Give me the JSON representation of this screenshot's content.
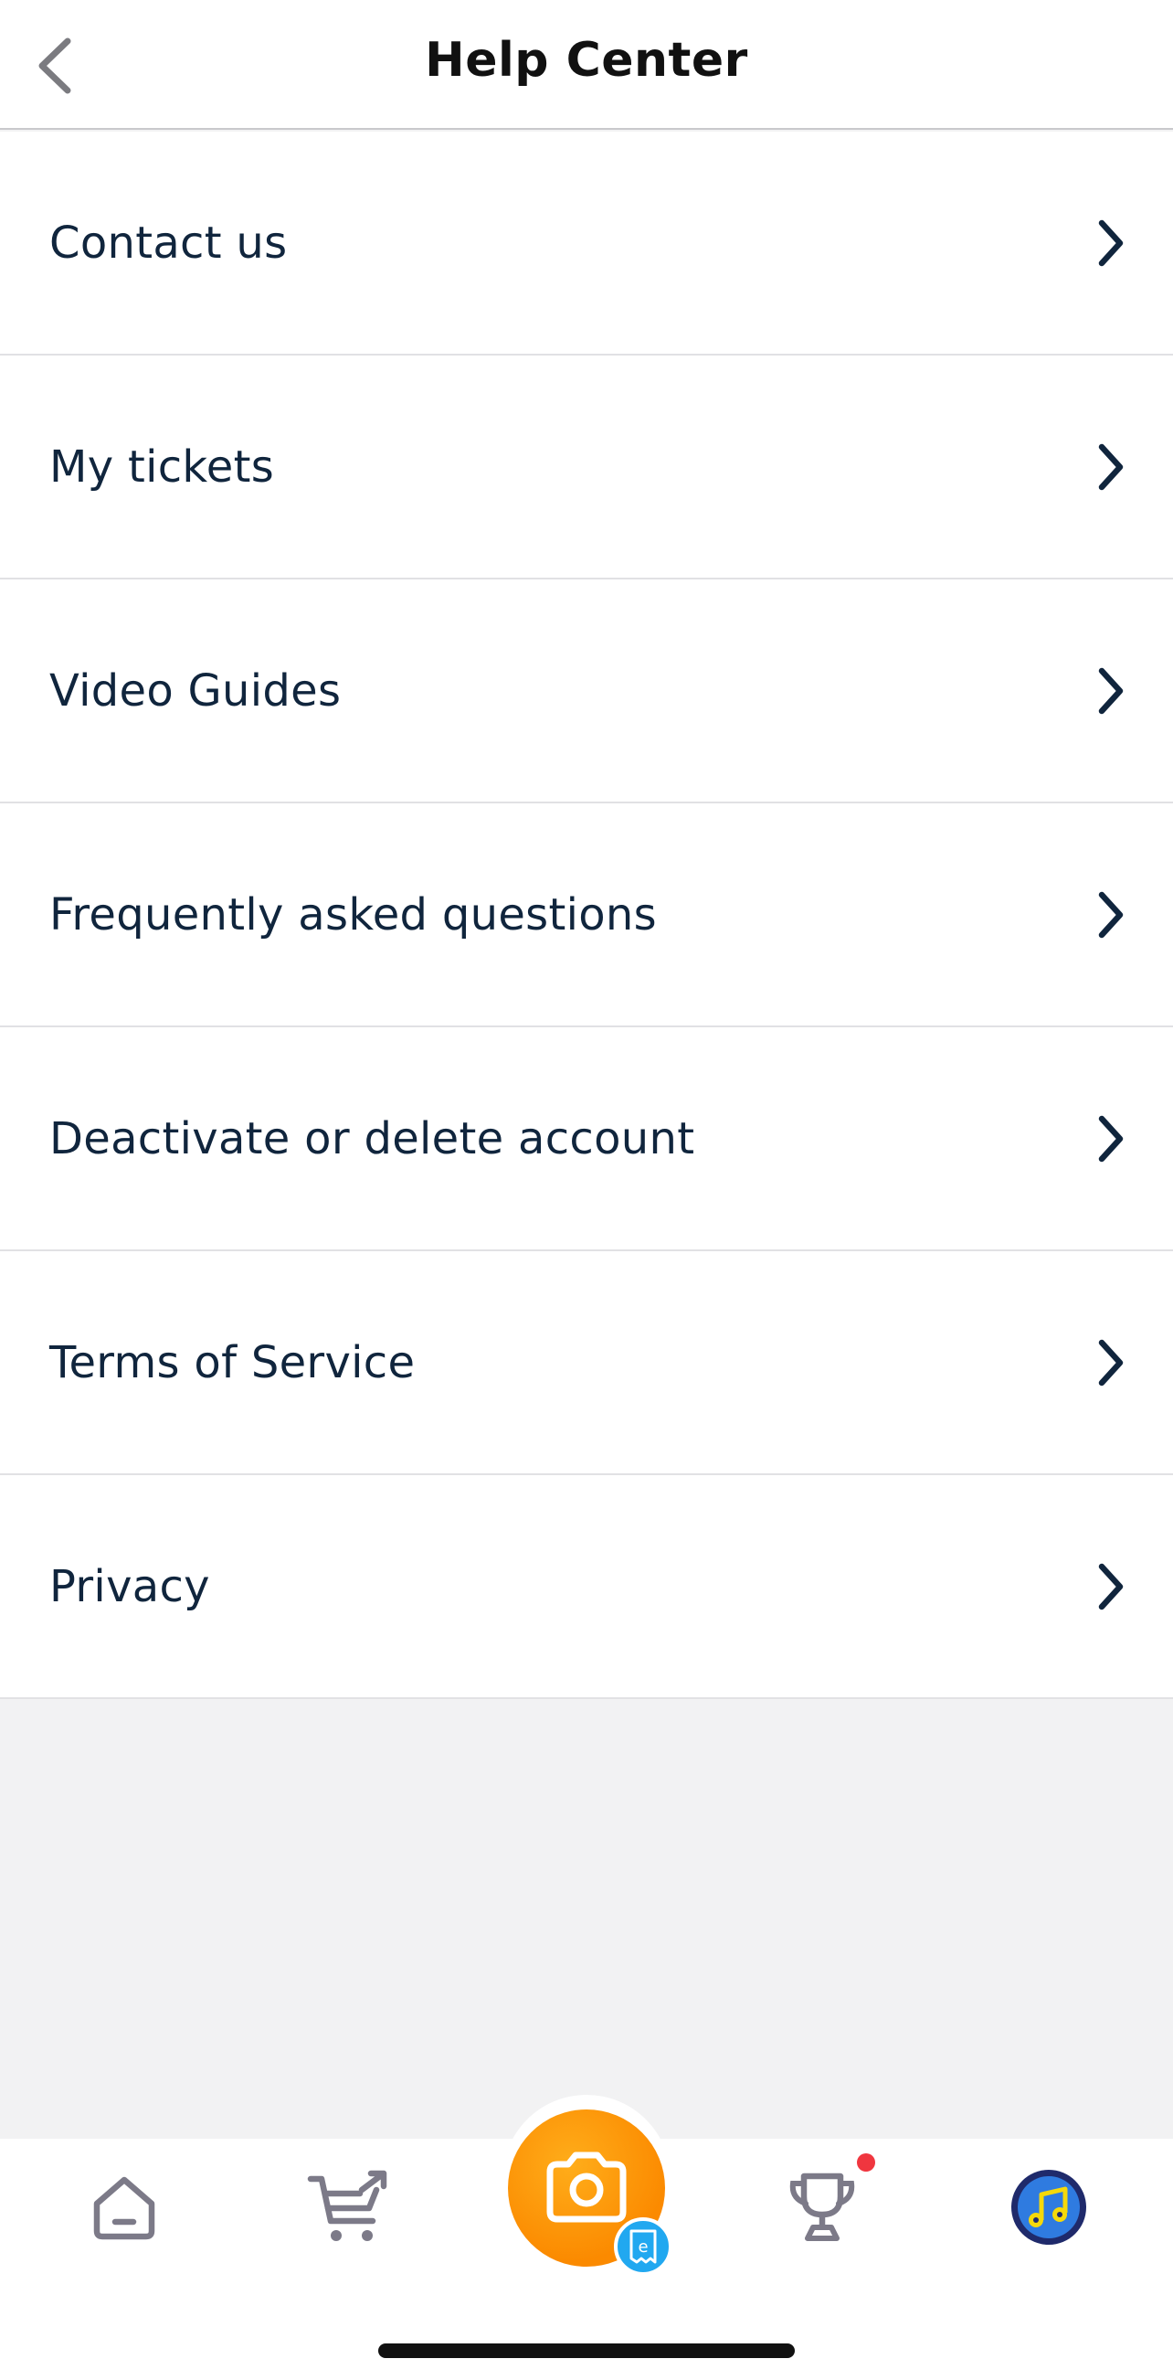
{
  "header": {
    "title": "Help Center"
  },
  "menu": {
    "items": [
      {
        "label": "Contact us"
      },
      {
        "label": "My tickets"
      },
      {
        "label": "Video Guides"
      },
      {
        "label": "Frequently asked questions"
      },
      {
        "label": "Deactivate or delete account"
      },
      {
        "label": "Terms of Service"
      },
      {
        "label": "Privacy"
      }
    ]
  },
  "tabbar": {
    "tabs": [
      {
        "icon": "home-icon"
      },
      {
        "icon": "cart-icon"
      },
      {
        "icon": "camera-icon",
        "badge_icon": "receipt-icon",
        "badge_text": "e"
      },
      {
        "icon": "trophy-icon",
        "has_notification": true
      },
      {
        "icon": "music-avatar-icon"
      }
    ]
  },
  "colors": {
    "text_primary": "#10253d",
    "camera_orange": "#fb8a00",
    "badge_blue": "#21a8f0",
    "notification_red": "#f0363f",
    "avatar_navy": "#1f2a6b",
    "avatar_yellow": "#f5d90a"
  }
}
